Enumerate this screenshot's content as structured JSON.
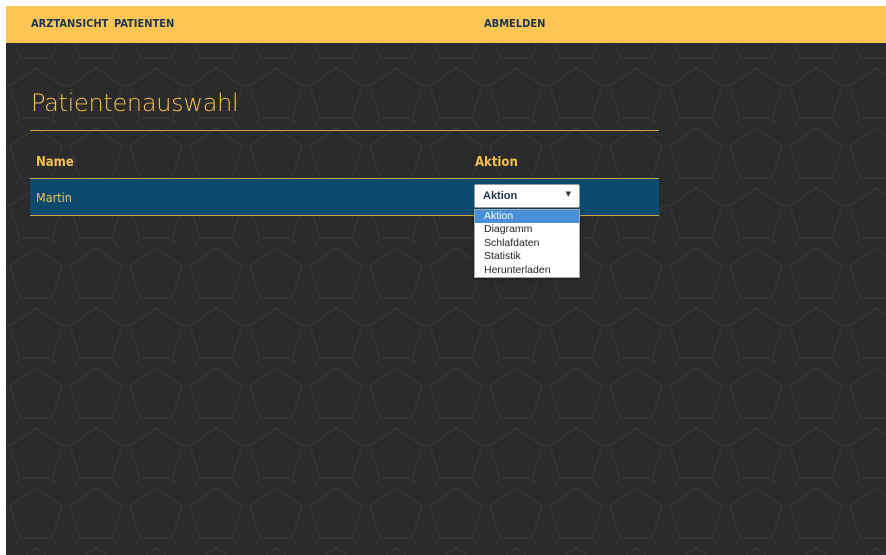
{
  "nav": {
    "arztansicht": "ARZTANSICHT",
    "patienten": "PATIENTEN",
    "abmelden": "ABMELDEN"
  },
  "page": {
    "title": "Patientenauswahl"
  },
  "table": {
    "headers": {
      "name": "Name",
      "aktion": "Aktion"
    },
    "rows": [
      {
        "name": "Martin",
        "aktion_selected": "Aktion"
      }
    ]
  },
  "dropdown": {
    "options": [
      "Aktion",
      "Diagramm",
      "Schlafdaten",
      "Statistik",
      "Herunterladen"
    ],
    "highlighted": "Aktion"
  },
  "colors": {
    "navbar": "#fdc654",
    "background": "#2b2b2b",
    "accent_text": "#f5c04e",
    "row_highlight": "#0d4a6f",
    "option_highlight": "#4a90d9"
  }
}
